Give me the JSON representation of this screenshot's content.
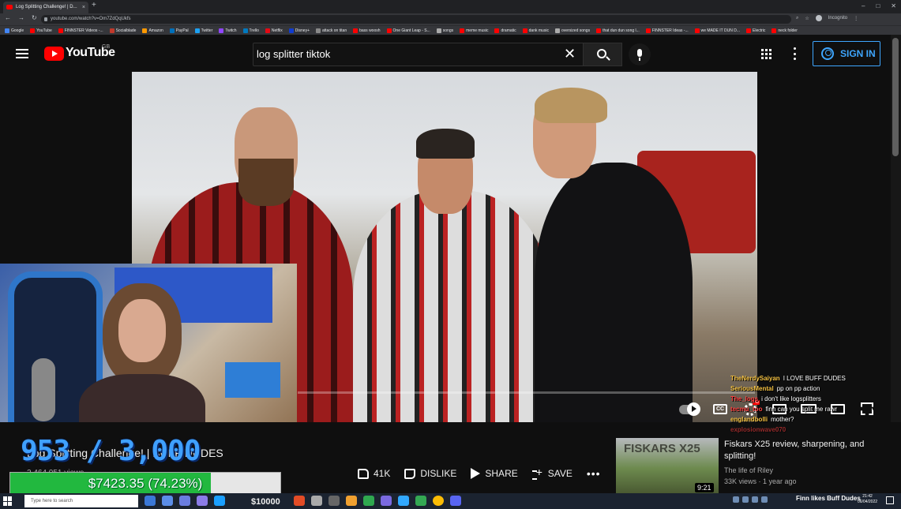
{
  "browser": {
    "tab_title": "Log Splitting Challenge! | D...",
    "url": "youtube.com/watch?v=Om7ZdQqUkfs",
    "incognito_label": "Incognito",
    "bookmarks": [
      {
        "label": "Google",
        "color": "#4285f4"
      },
      {
        "label": "YouTube",
        "color": "#ff0000"
      },
      {
        "label": "FINNSTER Videos -...",
        "color": "#ff0000"
      },
      {
        "label": "Socialblade",
        "color": "#c0392b"
      },
      {
        "label": "Amazon",
        "color": "#ff9900"
      },
      {
        "label": "PayPal",
        "color": "#0070ba"
      },
      {
        "label": "Twitter",
        "color": "#1da1f2"
      },
      {
        "label": "Twitch",
        "color": "#9146ff"
      },
      {
        "label": "Trello",
        "color": "#0079bf"
      },
      {
        "label": "Netflix",
        "color": "#e50914"
      },
      {
        "label": "Disney+",
        "color": "#113ccf"
      },
      {
        "label": "attack on titan",
        "color": "#888888"
      },
      {
        "label": "bass woosh",
        "color": "#ff0000"
      },
      {
        "label": "One Giant Leap - S...",
        "color": "#ff0000"
      },
      {
        "label": "songs",
        "color": "#aaaaaa"
      },
      {
        "label": "meme music",
        "color": "#ff0000"
      },
      {
        "label": "dramatic",
        "color": "#ff0000"
      },
      {
        "label": "dank music",
        "color": "#ff0000"
      },
      {
        "label": "oversized songs",
        "color": "#aaaaaa"
      },
      {
        "label": "that dun dun song l...",
        "color": "#ff0000"
      },
      {
        "label": "FINNSTER Ideas -...",
        "color": "#ff0000"
      },
      {
        "label": "we MADE IT DUN D...",
        "color": "#ff0000"
      },
      {
        "label": "Electric",
        "color": "#ff0000"
      },
      {
        "label": "neck folder",
        "color": "#ff0000"
      }
    ]
  },
  "youtube": {
    "logo_text": "YouTube",
    "region": "GB",
    "search_value": "log splitter tiktok",
    "sign_in_label": "SIGN IN"
  },
  "stream": {
    "counter_text": "953 / 3,000",
    "donation_amount": "$7423.35 (74.23%)",
    "donation_fraction": 0.7423,
    "taskbar_total": "$10000"
  },
  "video": {
    "title": "Log Splitting Challenge! | BUFF DUDES",
    "views": "2,464,051 views",
    "likes": "41K",
    "dislike_label": "DISLIKE",
    "share_label": "SHARE",
    "save_label": "SAVE"
  },
  "related": {
    "thumb_text": "FISKARS X25",
    "title": "Fiskars X25 review, sharpening, and splitting!",
    "channel": "The life of Riley",
    "meta": "33K views · 1 year ago",
    "duration": "9:21"
  },
  "chat": [
    {
      "user": "TheNerdySaiyan",
      "msg": "I LOVE BUFF DUDES",
      "color": "#f5c242"
    },
    {
      "user": "SeriousMental",
      "msg": "pp on pp action",
      "color": "#f5c242"
    },
    {
      "user": "The_logs",
      "msg": "i don't like logsplitters",
      "color": "#ff4040"
    },
    {
      "user": "tecmu_too",
      "msg": "finn can you split me rawr",
      "color": "#ff4040"
    },
    {
      "user": "englandbolli",
      "msg": "mother?",
      "color": "#f5c242"
    },
    {
      "user": "explosionwave070",
      "msg": "",
      "color": "#ff4040"
    }
  ],
  "taskbar": {
    "search_placeholder": "Type here to search",
    "notification": "Finn likes Buff Dudes",
    "time": "21:42",
    "date": "06/04/2022"
  }
}
